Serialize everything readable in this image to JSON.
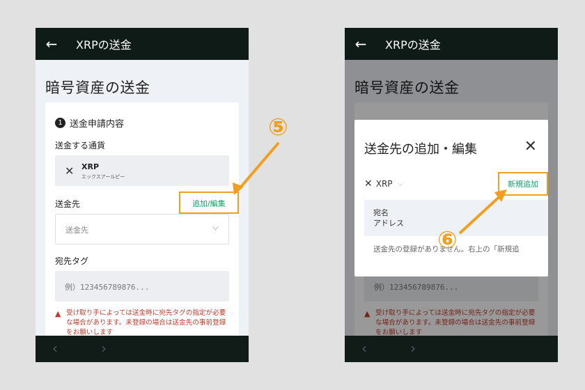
{
  "left": {
    "appbar_title": "XRPの送金",
    "heading": "暗号資産の送金",
    "step_number": "1",
    "step_title": "送金申請内容",
    "currency_label": "送金する通貨",
    "currency_code": "XRP",
    "currency_name": "エックスアールピー",
    "destination_label": "送金先",
    "add_edit_link": "追加/編集",
    "destination_placeholder": "送金先",
    "tag_label": "宛先タグ",
    "tag_placeholder": "例）123456789876...",
    "warning": "受け取り手によっては送金時に宛先タグの指定が必要な場合があります。未登録の場合は送金先の事前登録をお願いします"
  },
  "right": {
    "appbar_title": "XRPの送金",
    "heading": "暗号資産の送金",
    "modal_title": "送金先の追加・編集",
    "currency_code": "XRP",
    "new_add_link": "新規追加",
    "col_name": "宛名",
    "col_address": "アドレス",
    "empty_message": "送金先の登録がありません。右上の「新規追",
    "tag_placeholder": "例）123456789876...",
    "warning": "受け取り手によっては送金時に宛先タグの指定が必要な場合があります。未登録の場合は送金先の事前登録をお願いします"
  },
  "annotations": {
    "step5": "⑤",
    "step6": "⑥"
  },
  "icons": {
    "back": "arrow-left",
    "close": "x-mark",
    "xrp": "xrp-logo",
    "chevron": "chevron-down",
    "warning": "warning-triangle"
  },
  "colors": {
    "accent": "#0ea56a",
    "annotation": "#f0a020",
    "appbar": "#0f1b17",
    "warning": "#c0392b"
  }
}
